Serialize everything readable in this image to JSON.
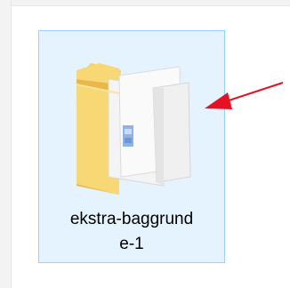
{
  "explorer": {
    "folder": {
      "name_line_1": "ekstra-baggrund",
      "name_line_2": "e-1",
      "icon": "folder-icon",
      "selected": true
    }
  },
  "colors": {
    "selection_background": "#e5f3ff",
    "selection_border": "#99d1ff",
    "folder_yellow": "#f8d775",
    "annotation_arrow": "#e81123"
  }
}
